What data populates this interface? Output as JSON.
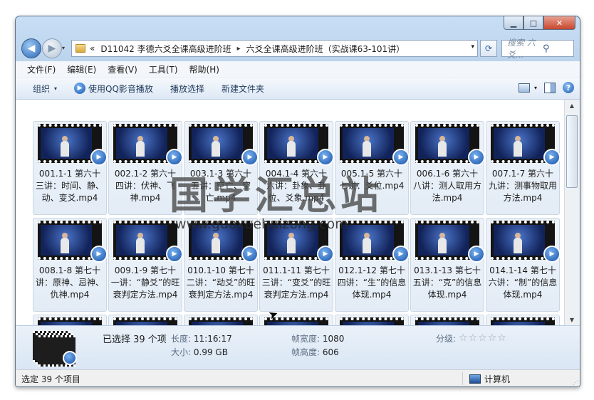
{
  "titlebar": {
    "min_glyph": "▁",
    "max_glyph": "□",
    "close_glyph": "✕"
  },
  "nav": {
    "back_glyph": "◀",
    "forward_glyph": "▶",
    "history_glyph": "▾"
  },
  "address": {
    "chevrons": "«",
    "crumbs": [
      "D11042 李德六爻全课高级进阶班",
      "六爻全课高级进阶班（实战课63-101讲）"
    ],
    "separator": "▸",
    "dropdown_glyph": "▾",
    "refresh_glyph": "⟳"
  },
  "search": {
    "placeholder": "搜索 六爻...",
    "icon_glyph": "⚲"
  },
  "menu": [
    "文件(F)",
    "编辑(E)",
    "查看(V)",
    "工具(T)",
    "帮助(H)"
  ],
  "commands": {
    "organize": "组织",
    "play_qq": "使用QQ影音播放",
    "play_selection": "播放选择",
    "new_folder": "新建文件夹",
    "dropdown_glyph": "▾",
    "help_glyph": "?"
  },
  "files": [
    {
      "name": "001.1-1 第六十三讲：时间、静、动、变爻.mp4"
    },
    {
      "name": "002.1-2 第六十四讲：伏神、飞神.mp4"
    },
    {
      "name": "003.1-3 第六十五讲：空亡、空亡.mp4"
    },
    {
      "name": "004.1-4 第六十六讲：卦象、卦位、爻象.mp4"
    },
    {
      "name": "005.1-5 第六十七讲：爻位.mp4"
    },
    {
      "name": "006.1-6 第六十八讲：测人取用方法.mp4"
    },
    {
      "name": "007.1-7 第六十九讲：测事物取用方法.mp4"
    },
    {
      "name": "008.1-8 第七十讲：原神、忌神、仇神.mp4"
    },
    {
      "name": "009.1-9 第七十一讲：“静爻”的旺衰判定方法.mp4"
    },
    {
      "name": "010.1-10 第七十二讲：“动爻”的旺衰判定方法.mp4"
    },
    {
      "name": "011.1-11 第七十三讲：“变爻”的旺衰判定方法.mp4"
    },
    {
      "name": "012.1-12 第七十四讲：“生”的信息体现.mp4"
    },
    {
      "name": "013.1-13 第七十五讲：“克”的信息体现.mp4"
    },
    {
      "name": "014.1-14 第七十六讲：“制”的信息体现.mp4"
    },
    {
      "name": ""
    },
    {
      "name": ""
    },
    {
      "name": ""
    },
    {
      "name": ""
    },
    {
      "name": ""
    },
    {
      "name": ""
    },
    {
      "name": ""
    }
  ],
  "watermark": {
    "text": "国学汇总站",
    "url": "www.guoxuehuizong.com"
  },
  "details": {
    "selected": "已选择 39 个项",
    "length_label": "长度:",
    "length_value": "11:16:17",
    "size_label": "大小:",
    "size_value": "0.99 GB",
    "frame_width_label": "帧宽度:",
    "frame_width_value": "1080",
    "frame_height_label": "帧高度:",
    "frame_height_value": "606",
    "rating_label": "分级:",
    "rating_stars": 0,
    "star_glyph": "☆"
  },
  "status": {
    "left": "选定 39 个项目",
    "right": "计算机"
  },
  "scroll": {
    "up_glyph": "▲",
    "down_glyph": "▼"
  }
}
